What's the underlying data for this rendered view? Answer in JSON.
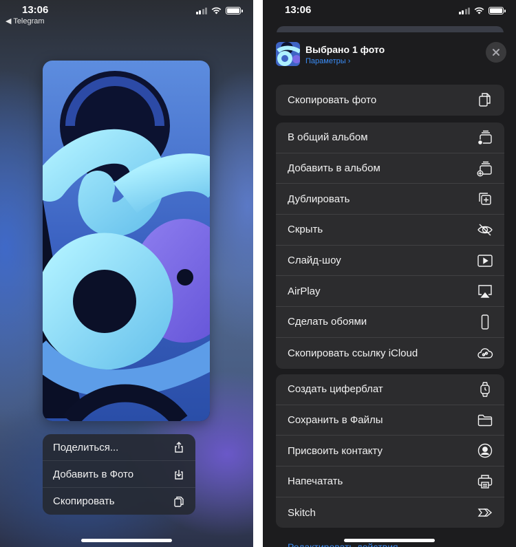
{
  "left": {
    "status": {
      "time": "13:06",
      "back_app": "◀ Telegram"
    },
    "context_menu": [
      {
        "label": "Поделиться...",
        "icon": "share-icon"
      },
      {
        "label": "Добавить в Фото",
        "icon": "download-icon"
      },
      {
        "label": "Скопировать",
        "icon": "copy-icon"
      }
    ]
  },
  "right": {
    "status": {
      "time": "13:06"
    },
    "header": {
      "title": "Выбрано 1 фото",
      "subtitle": "Параметры ›"
    },
    "group1": [
      {
        "label": "Скопировать фото",
        "icon": "copy-doc-icon"
      }
    ],
    "group2": [
      {
        "label": "В общий альбом",
        "icon": "shared-album-icon"
      },
      {
        "label": "Добавить в альбом",
        "icon": "add-album-icon"
      },
      {
        "label": "Дублировать",
        "icon": "duplicate-icon"
      },
      {
        "label": "Скрыть",
        "icon": "eye-slash-icon"
      },
      {
        "label": "Слайд-шоу",
        "icon": "play-icon"
      },
      {
        "label": "AirPlay",
        "icon": "airplay-icon"
      },
      {
        "label": "Сделать обоями",
        "icon": "phone-icon"
      },
      {
        "label": "Скопировать ссылку iCloud",
        "icon": "cloud-link-icon"
      }
    ],
    "group3": [
      {
        "label": "Создать циферблат",
        "icon": "watch-icon"
      },
      {
        "label": "Сохранить в Файлы",
        "icon": "folder-icon"
      },
      {
        "label": "Присвоить контакту",
        "icon": "contact-icon"
      },
      {
        "label": "Напечатать",
        "icon": "printer-icon"
      },
      {
        "label": "Skitch",
        "icon": "skitch-icon"
      }
    ],
    "edit_actions": "Редактировать действия..."
  },
  "colors": {
    "accent": "#3b8cf5",
    "sheet_bg": "#1c1c1e",
    "row_bg": "#2c2c2e"
  }
}
